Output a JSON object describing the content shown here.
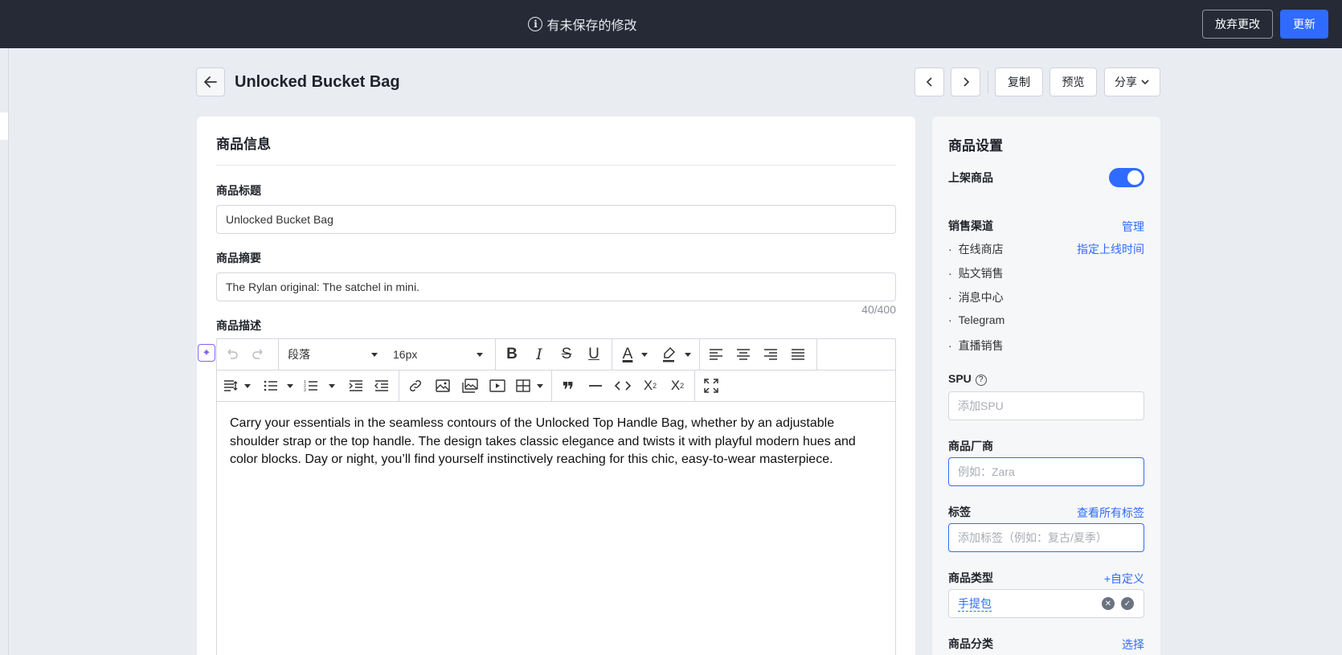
{
  "topbar": {
    "unsaved_text": "有未保存的修改",
    "discard_label": "放弃更改",
    "update_label": "更新"
  },
  "header": {
    "title": "Unlocked Bucket Bag",
    "prev_label": "‹",
    "next_label": "›",
    "copy_label": "复制",
    "preview_label": "预览",
    "share_label": "分享"
  },
  "product_info": {
    "section_title": "商品信息",
    "title_label": "商品标题",
    "title_value": "Unlocked Bucket Bag",
    "summary_label": "商品摘要",
    "summary_value": "The Rylan original: The satchel in mini.",
    "summary_counter": "40/400",
    "description_label": "商品描述",
    "editor": {
      "paragraph_select": "段落",
      "fontsize_select": "16px",
      "content": "Carry your essentials in the seamless contours of the Unlocked Top Handle Bag, whether by an adjustable shoulder strap or the top handle. The design takes classic elegance and twists it with playful modern hues and color blocks. Day or night, you’ll find yourself instinctively reaching for this chic, easy-to-wear masterpiece."
    }
  },
  "settings": {
    "section_title": "商品设置",
    "publish_label": "上架商品",
    "publish_on": true,
    "channels_label": "销售渠道",
    "channels_manage": "管理",
    "schedule_link": "指定上线时间",
    "channels": [
      "在线商店",
      "贴文销售",
      "消息中心",
      "Telegram",
      "直播销售"
    ],
    "spu_label": "SPU",
    "spu_placeholder": "添加SPU",
    "vendor_label": "商品厂商",
    "vendor_placeholder": "例如：Zara",
    "tags_label": "标签",
    "tags_link": "查看所有标签",
    "tags_placeholder": "添加标签（例如：复古/夏季）",
    "type_label": "商品类型",
    "type_custom": "+自定义",
    "type_value": "手提包",
    "category_label": "商品分类",
    "category_select": "选择"
  },
  "colors": {
    "accent": "#2f6bff",
    "topbar_bg": "#252a36",
    "page_bg": "#e9ecf1",
    "ai_purple": "#8b5cf6"
  }
}
